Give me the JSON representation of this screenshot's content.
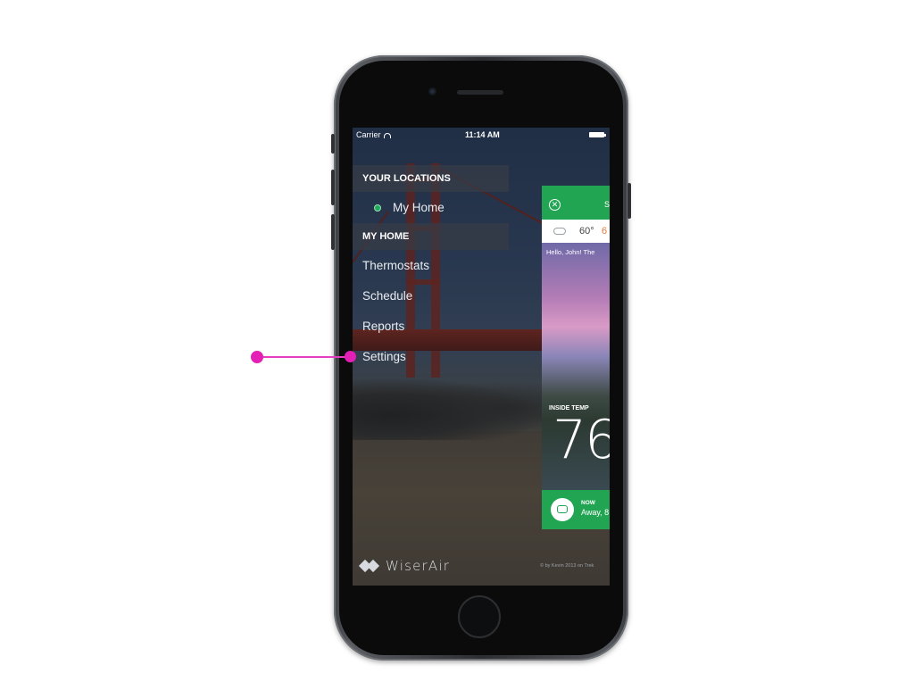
{
  "status_bar": {
    "carrier": "Carrier",
    "time": "11:14 AM"
  },
  "menu": {
    "locations_header": "YOUR LOCATIONS",
    "location_item": "My Home",
    "home_header": "MY HOME",
    "items": [
      "Thermostats",
      "Schedule",
      "Reports",
      "Settings"
    ]
  },
  "brand": {
    "name": "WiserAir",
    "credit": "© by Kevin 2013 on Trek"
  },
  "panel": {
    "title_partial": "S",
    "weather_temp": "60°",
    "weather_temp2": "6",
    "greeting": "Hello, John! The",
    "inside_label": "INSIDE TEMP",
    "inside_value": "76",
    "mode_label": "NOW",
    "mode_value": "Away, 8"
  },
  "colors": {
    "accent_green": "#22a552",
    "annotation_pink": "#e31fb6"
  },
  "icons": [
    "wifi-icon",
    "battery-icon",
    "location-dot-icon",
    "brand-logo-icon",
    "close-icon",
    "cloud-icon",
    "car-icon"
  ]
}
